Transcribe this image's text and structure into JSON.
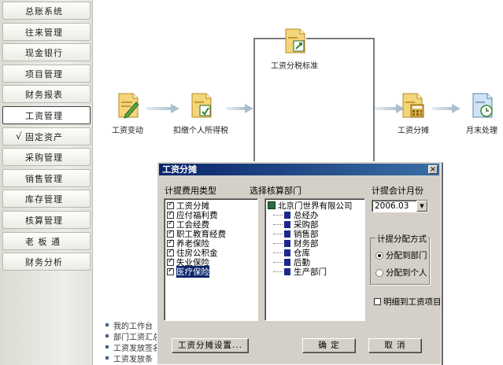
{
  "sidebar": {
    "items": [
      {
        "label": "总账系统"
      },
      {
        "label": "往来管理"
      },
      {
        "label": "现金银行"
      },
      {
        "label": "项目管理"
      },
      {
        "label": "财务报表"
      },
      {
        "label": "工资管理"
      },
      {
        "label": "固定资产",
        "check": "√"
      },
      {
        "label": "采购管理"
      },
      {
        "label": "销售管理"
      },
      {
        "label": "库存管理"
      },
      {
        "label": "核算管理"
      },
      {
        "label": "老 板 通"
      },
      {
        "label": "财务分析"
      }
    ]
  },
  "flow": {
    "nodes": {
      "salary_change": "工资变动",
      "income_tax": "扣缴个人所得税",
      "tax_standard": "工资分税标准",
      "salary_allocation": "工资分摊",
      "month_end": "月末处理"
    },
    "info_list": [
      "我的工作台",
      "部门工资汇总",
      "工资发放签名",
      "工资发放条"
    ]
  },
  "dialog": {
    "title": "工资分摊",
    "close": "×",
    "fee_type_label": "计提费用类型",
    "fee_types": [
      {
        "label": "工资分摊",
        "checked": true
      },
      {
        "label": "应付福利费",
        "checked": true
      },
      {
        "label": "工会经费",
        "checked": true
      },
      {
        "label": "职工教育经费",
        "checked": true
      },
      {
        "label": "养老保险",
        "checked": true
      },
      {
        "label": "住房公积金",
        "checked": true
      },
      {
        "label": "失业保险",
        "checked": true
      },
      {
        "label": "医疗保险",
        "checked": true,
        "selected": true
      }
    ],
    "dept_label": "选择核算部门",
    "company": "北京门世界有限公司",
    "departments": [
      "总经办",
      "采购部",
      "销售部",
      "财务部",
      "仓库",
      "后勤",
      "生产部门"
    ],
    "period_label": "计提会计月份",
    "period_value": "2006.03",
    "method_label": "计提分配方式",
    "method_options": [
      {
        "label": "分配到部门",
        "selected": true
      },
      {
        "label": "分配到个人",
        "selected": false
      }
    ],
    "detail_label": "明细到工资项目",
    "settings_button": "工资分摊设置...",
    "ok_button": "确 定",
    "cancel_button": "取 消"
  },
  "colors": {
    "titlebar_start": "#0a246a",
    "titlebar_end": "#3a6ea5",
    "selection": "#0a246a",
    "dialog_face": "#d4d0c8"
  }
}
